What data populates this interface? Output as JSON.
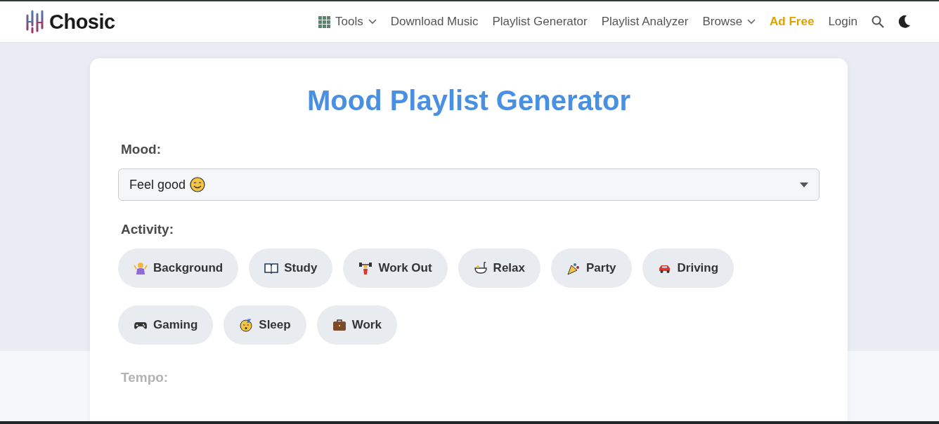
{
  "nav": {
    "brand": "Chosic",
    "items": [
      {
        "label": "Tools",
        "kind": "grid-menu",
        "highlight": false
      },
      {
        "label": "Download Music",
        "kind": "link",
        "highlight": false
      },
      {
        "label": "Playlist Generator",
        "kind": "link",
        "highlight": false
      },
      {
        "label": "Playlist Analyzer",
        "kind": "link",
        "highlight": false
      },
      {
        "label": "Browse",
        "kind": "menu",
        "highlight": false
      },
      {
        "label": "Ad Free",
        "kind": "link",
        "highlight": true
      },
      {
        "label": "Login",
        "kind": "link",
        "highlight": false
      }
    ]
  },
  "title": "Mood Playlist Generator",
  "mood": {
    "label": "Mood:",
    "value": "Feel good"
  },
  "activity": {
    "label": "Activity:",
    "options": [
      {
        "label": "Background",
        "selected": false
      },
      {
        "label": "Study",
        "selected": false
      },
      {
        "label": "Work Out",
        "selected": false
      },
      {
        "label": "Relax",
        "selected": false
      },
      {
        "label": "Party",
        "selected": false
      },
      {
        "label": "Driving",
        "selected": false
      },
      {
        "label": "Gaming",
        "selected": false
      },
      {
        "label": "Sleep",
        "selected": false
      },
      {
        "label": "Work",
        "selected": false
      }
    ]
  },
  "tempo": {
    "label": "Tempo:",
    "disabled": true
  }
}
